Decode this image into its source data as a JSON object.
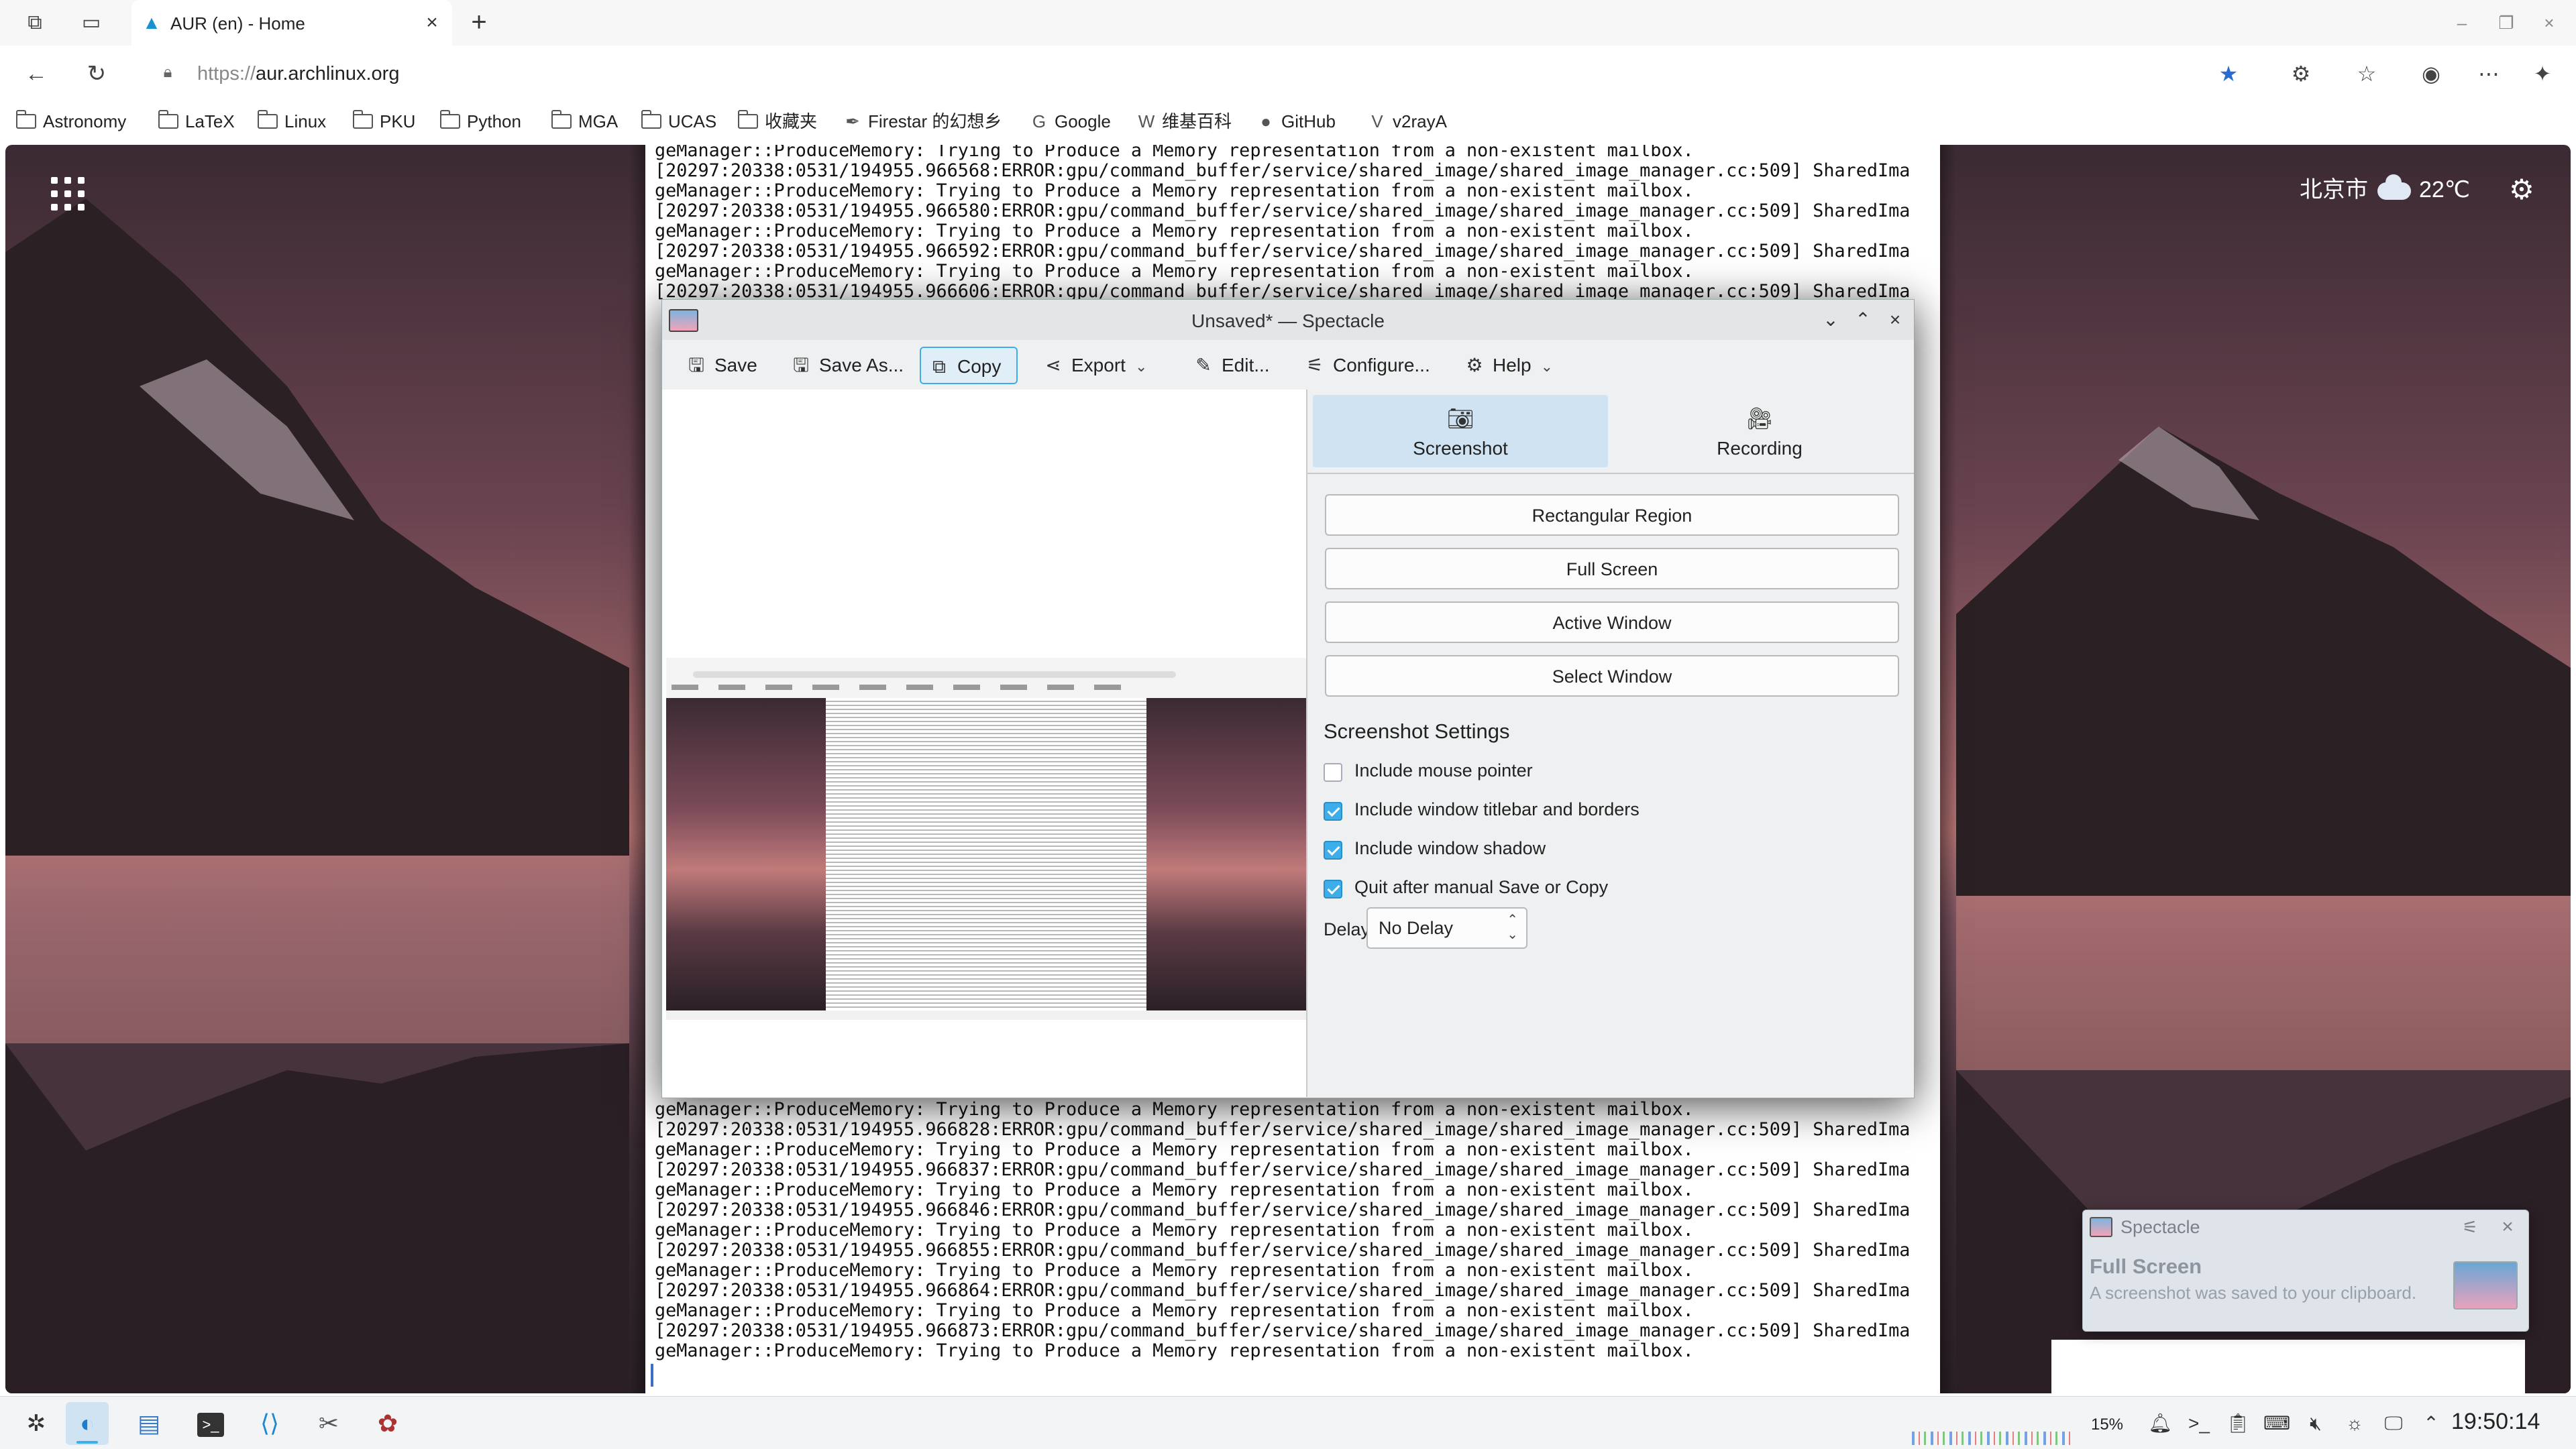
{
  "browser": {
    "tab_title": "AUR (en) - Home",
    "tab_favicon": "arch-linux-icon",
    "url_proto": "https://",
    "url_host": "aur.archlinux.org"
  },
  "bookmarks": [
    {
      "label": "Astronomy",
      "icon": "folder-icon"
    },
    {
      "label": "LaTeX",
      "icon": "folder-icon"
    },
    {
      "label": "Linux",
      "icon": "folder-icon"
    },
    {
      "label": "PKU",
      "icon": "folder-icon"
    },
    {
      "label": "Python",
      "icon": "folder-icon"
    },
    {
      "label": "MGA",
      "icon": "folder-icon"
    },
    {
      "label": "UCAS",
      "icon": "folder-icon"
    },
    {
      "label": "收藏夹",
      "icon": "folder-icon"
    },
    {
      "label": "Firestar 的幻想乡",
      "icon": "feather-icon"
    },
    {
      "label": "Google",
      "icon": "google-icon"
    },
    {
      "label": "维基百科",
      "icon": "wikipedia-icon"
    },
    {
      "label": "GitHub",
      "icon": "github-icon"
    },
    {
      "label": "v2rayA",
      "icon": "v2raya-icon"
    }
  ],
  "desktop": {
    "weather_city": "北京市",
    "weather_temp": "22℃"
  },
  "terminal": {
    "top_lines": [
      "geManager::ProduceMemory: Trying to Produce a Memory representation from a non-existent mailbox.",
      "[20297:20338:0531/194955.966568:ERROR:gpu/command_buffer/service/shared_image/shared_image_manager.cc:509] SharedIma",
      "geManager::ProduceMemory: Trying to Produce a Memory representation from a non-existent mailbox.",
      "[20297:20338:0531/194955.966580:ERROR:gpu/command_buffer/service/shared_image/shared_image_manager.cc:509] SharedIma",
      "geManager::ProduceMemory: Trying to Produce a Memory representation from a non-existent mailbox.",
      "[20297:20338:0531/194955.966592:ERROR:gpu/command_buffer/service/shared_image/shared_image_manager.cc:509] SharedIma",
      "geManager::ProduceMemory: Trying to Produce a Memory representation from a non-existent mailbox.",
      "[20297:20338:0531/194955.966606:ERROR:gpu/command_buffer/service/shared_image/shared_image_manager.cc:509] SharedIma"
    ],
    "bottom_lines": [
      "geManager::ProduceMemory: Trying to Produce a Memory representation from a non-existent mailbox.",
      "[20297:20338:0531/194955.966828:ERROR:gpu/command_buffer/service/shared_image/shared_image_manager.cc:509] SharedIma",
      "geManager::ProduceMemory: Trying to Produce a Memory representation from a non-existent mailbox.",
      "[20297:20338:0531/194955.966837:ERROR:gpu/command_buffer/service/shared_image/shared_image_manager.cc:509] SharedIma",
      "geManager::ProduceMemory: Trying to Produce a Memory representation from a non-existent mailbox.",
      "[20297:20338:0531/194955.966846:ERROR:gpu/command_buffer/service/shared_image/shared_image_manager.cc:509] SharedIma",
      "geManager::ProduceMemory: Trying to Produce a Memory representation from a non-existent mailbox.",
      "[20297:20338:0531/194955.966855:ERROR:gpu/command_buffer/service/shared_image/shared_image_manager.cc:509] SharedIma",
      "geManager::ProduceMemory: Trying to Produce a Memory representation from a non-existent mailbox.",
      "[20297:20338:0531/194955.966864:ERROR:gpu/command_buffer/service/shared_image/shared_image_manager.cc:509] SharedIma",
      "geManager::ProduceMemory: Trying to Produce a Memory representation from a non-existent mailbox.",
      "[20297:20338:0531/194955.966873:ERROR:gpu/command_buffer/service/shared_image/shared_image_manager.cc:509] SharedIma",
      "geManager::ProduceMemory: Trying to Produce a Memory representation from a non-existent mailbox."
    ]
  },
  "spectacle": {
    "title": "Unsaved* — Spectacle",
    "toolbar": {
      "save": "Save",
      "save_as": "Save As...",
      "copy": "Copy",
      "export": "Export",
      "edit": "Edit...",
      "configure": "Configure...",
      "help": "Help"
    },
    "tabs": {
      "screenshot": "Screenshot",
      "recording": "Recording"
    },
    "capture": {
      "rect": "Rectangular Region",
      "full": "Full Screen",
      "active": "Active Window",
      "select": "Select Window"
    },
    "settings_title": "Screenshot Settings",
    "options": [
      {
        "label": "Include mouse pointer",
        "checked": false
      },
      {
        "label": "Include window titlebar and borders",
        "checked": true
      },
      {
        "label": "Include window shadow",
        "checked": true
      },
      {
        "label": "Quit after manual Save or Copy",
        "checked": true
      }
    ],
    "delay_label": "Delay:",
    "delay_value": "No Delay"
  },
  "notification": {
    "app": "Spectacle",
    "title": "Full Screen",
    "body": "A screenshot was saved to your clipboard."
  },
  "taskbar": {
    "cpu_percent": "15%",
    "clock": "19:50:14"
  },
  "colors": {
    "accent": "#3daee9",
    "selected_bg": "#cfe3f2"
  }
}
